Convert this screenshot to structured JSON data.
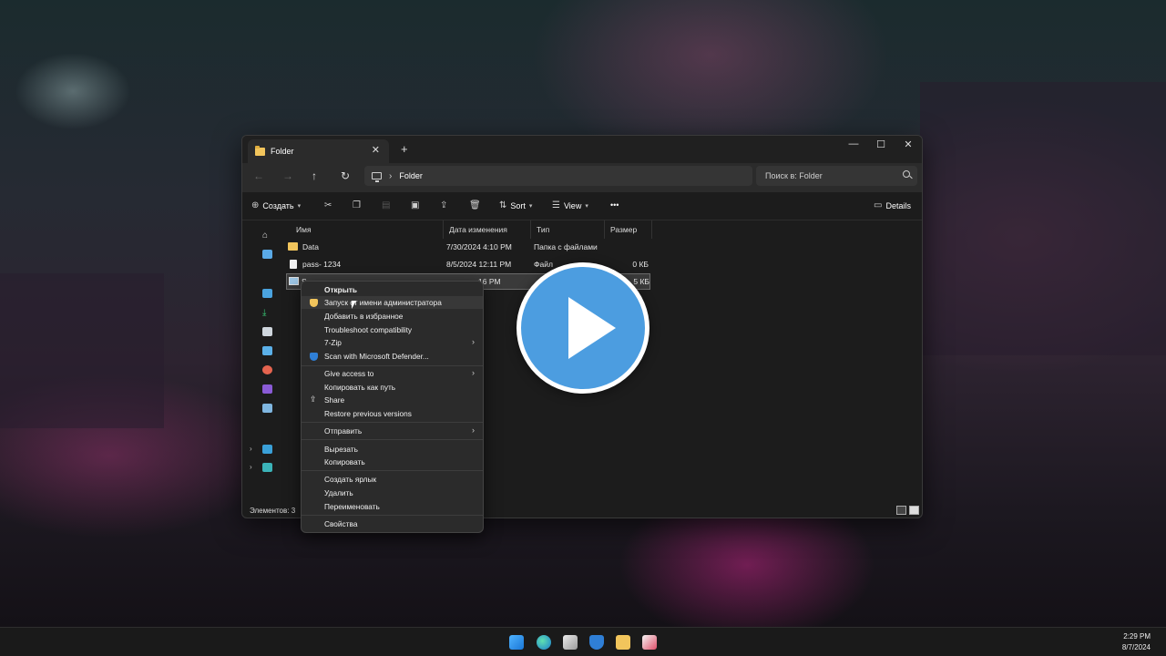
{
  "window": {
    "tab_title": "Folder",
    "tab_close": "✕",
    "tab_new": "+",
    "minimize": "—",
    "maximize": "☐",
    "close": "✕"
  },
  "nav": {
    "back": "←",
    "forward": "→",
    "up": "↑",
    "refresh": "↻",
    "breadcrumb_sep": "›",
    "path": "Folder",
    "search_placeholder": "Поиск в: Folder"
  },
  "toolbar": {
    "create_label": "Создать",
    "sort_label": "Sort",
    "view_label": "View",
    "more_label": "•••",
    "details_label": "Details"
  },
  "columns": [
    "Имя",
    "Дата изменения",
    "Тип",
    "Размер"
  ],
  "files": [
    {
      "name": "Data",
      "date": "7/30/2024 4:10 PM",
      "type": "Папка с файлами",
      "size": "",
      "icon": "folder-icon"
    },
    {
      "name": "pass- 1234",
      "date": "8/5/2024 12:11 PM",
      "type": "Файл",
      "size": "0 КБ",
      "icon": "file-icon"
    },
    {
      "name": "S",
      "date": "16 PM",
      "type": "",
      "size": "5 КБ",
      "icon": "exe-icon"
    }
  ],
  "status": {
    "items_count": "Элементов: 3"
  },
  "context_menu": [
    {
      "label": "Открыть",
      "bold": true,
      "icon": "",
      "submenu": false
    },
    {
      "label": "Запуск от имени администратора",
      "icon": "shield-icon",
      "submenu": false
    },
    {
      "label": "Добавить в избранное",
      "icon": "",
      "submenu": false
    },
    {
      "label": "Troubleshoot compatibility",
      "icon": "",
      "submenu": false
    },
    {
      "label": "7-Zip",
      "icon": "",
      "submenu": true
    },
    {
      "label": "Scan with Microsoft Defender...",
      "icon": "defender-icon",
      "submenu": false
    },
    {
      "label": "Give access to",
      "icon": "",
      "submenu": true
    },
    {
      "label": "Копировать как путь",
      "icon": "",
      "submenu": false
    },
    {
      "label": "Share",
      "icon": "share-icon",
      "submenu": false
    },
    {
      "label": "Restore previous versions",
      "icon": "",
      "submenu": false
    },
    {
      "label": "Отправить",
      "icon": "",
      "submenu": true
    },
    {
      "label": "Вырезать",
      "icon": "",
      "submenu": false
    },
    {
      "label": "Копировать",
      "icon": "",
      "submenu": false
    },
    {
      "label": "Создать ярлык",
      "icon": "",
      "submenu": false
    },
    {
      "label": "Удалить",
      "icon": "",
      "submenu": false
    },
    {
      "label": "Переименовать",
      "icon": "",
      "submenu": false
    },
    {
      "label": "Свойства",
      "icon": "",
      "submenu": false
    }
  ],
  "taskbar": {
    "apps": [
      "windows-start-icon",
      "edge-icon",
      "store-icon",
      "defender-icon",
      "file-explorer-icon",
      "snipping-tool-icon"
    ],
    "time": "2:29 PM",
    "date": "8/7/2024"
  },
  "colors": {
    "accent": "#4c9de0",
    "folder": "#f2c55c",
    "window_bg": "#1c1c1c",
    "menu_bg": "#2b2b2b"
  }
}
